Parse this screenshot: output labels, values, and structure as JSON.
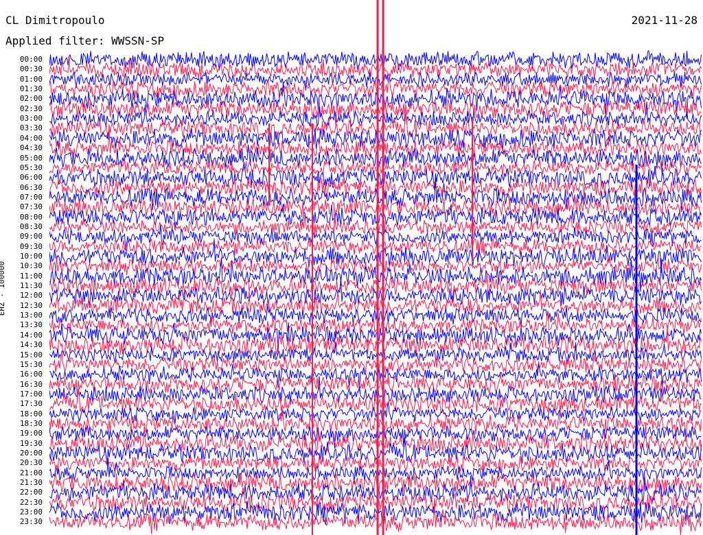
{
  "header": {
    "station": "CL Dimitropoulo",
    "filter": "Applied filter: WWSSN-SP",
    "date": "2021-11-28"
  },
  "chart_data": {
    "type": "line",
    "title": "CL Dimitropoulo",
    "subtitle": "Applied filter: WWSSN-SP",
    "date": "2021-11-28",
    "ylabel": "EHZ - 100000",
    "xlabel": "",
    "series_colors": [
      "#0000ff",
      "#ff1a4d"
    ],
    "grid": false,
    "trace_minutes": 30,
    "row_labels": [
      "00:00",
      "00:30",
      "01:00",
      "01:30",
      "02:00",
      "02:30",
      "03:00",
      "03:30",
      "04:00",
      "04:30",
      "05:00",
      "05:30",
      "06:00",
      "06:30",
      "07:00",
      "07:30",
      "08:00",
      "08:30",
      "09:00",
      "09:30",
      "10:00",
      "10:30",
      "11:00",
      "11:30",
      "12:00",
      "12:30",
      "13:00",
      "13:30",
      "14:00",
      "14:30",
      "15:00",
      "15:30",
      "16:00",
      "16:30",
      "17:00",
      "17:30",
      "18:00",
      "18:30",
      "19:00",
      "19:30",
      "20:00",
      "20:30",
      "21:00",
      "21:30",
      "22:00",
      "22:30",
      "23:00",
      "23:30"
    ]
  }
}
